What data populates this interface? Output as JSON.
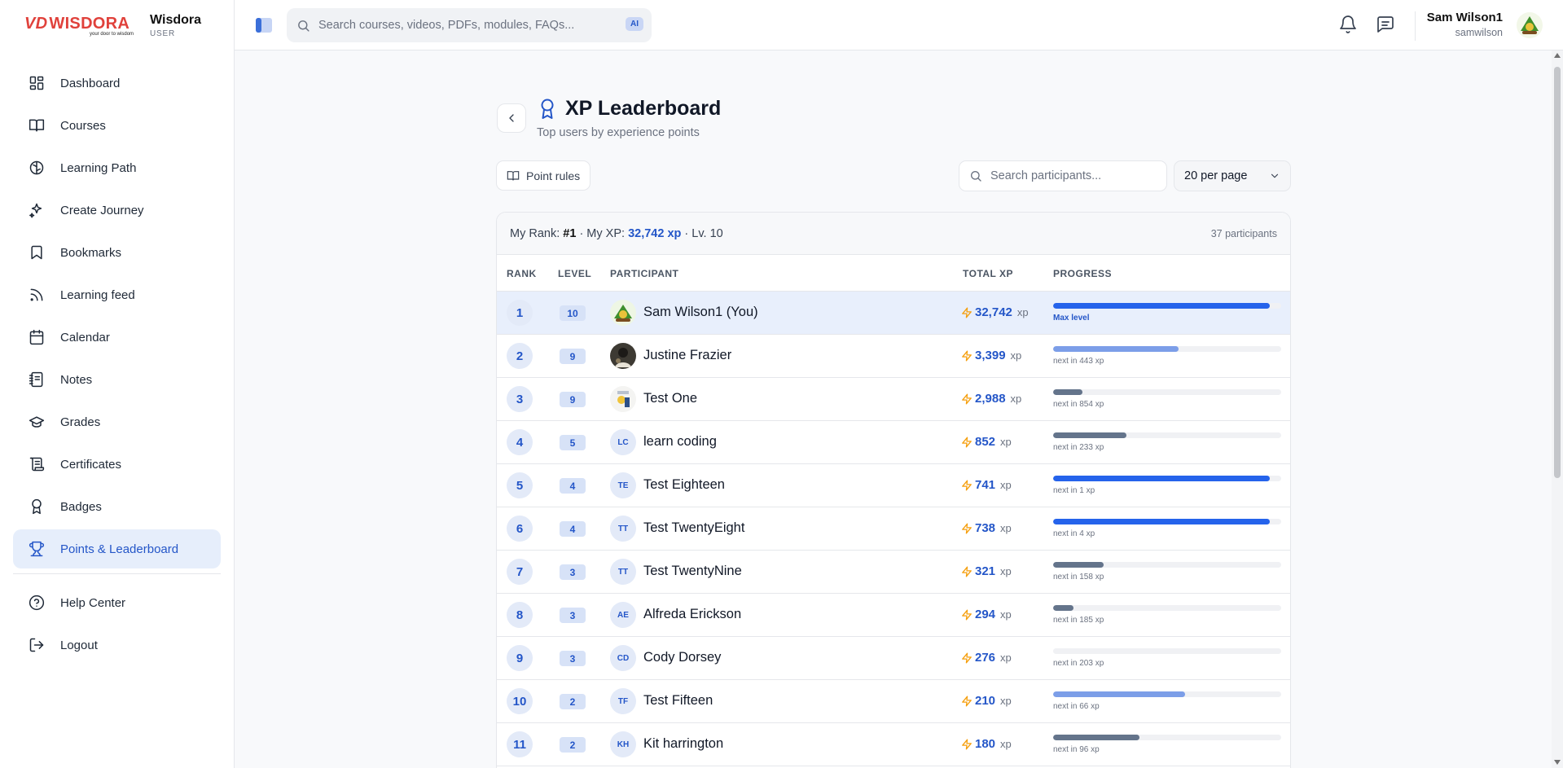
{
  "brand": {
    "logo_text": "WISDORA",
    "logo_mark": "VD",
    "logo_tagline": "your door to wisdom",
    "name": "Wisdora",
    "role": "USER"
  },
  "nav": {
    "items": [
      {
        "label": "Dashboard",
        "icon": "dashboard-icon"
      },
      {
        "label": "Courses",
        "icon": "book-open-icon"
      },
      {
        "label": "Learning Path",
        "icon": "brain-icon"
      },
      {
        "label": "Create Journey",
        "icon": "sparkles-icon"
      },
      {
        "label": "Bookmarks",
        "icon": "bookmark-icon"
      },
      {
        "label": "Learning feed",
        "icon": "rss-icon"
      },
      {
        "label": "Calendar",
        "icon": "calendar-icon"
      },
      {
        "label": "Notes",
        "icon": "notebook-icon"
      },
      {
        "label": "Grades",
        "icon": "graduation-cap-icon"
      },
      {
        "label": "Certificates",
        "icon": "scroll-icon"
      },
      {
        "label": "Badges",
        "icon": "award-icon"
      },
      {
        "label": "Points & Leaderboard",
        "icon": "trophy-icon",
        "active": true
      }
    ],
    "bottom": [
      {
        "label": "Help Center",
        "icon": "help-circle-icon"
      },
      {
        "label": "Logout",
        "icon": "logout-icon"
      }
    ]
  },
  "topbar": {
    "search_placeholder": "Search courses, videos, PDFs, modules, FAQs...",
    "ai_label": "AI",
    "user_name": "Sam Wilson1",
    "user_handle": "samwilson"
  },
  "page": {
    "title": "XP Leaderboard",
    "subtitle": "Top users by experience points",
    "rules_label": "Point rules",
    "search_placeholder": "Search participants...",
    "per_page": "20 per page"
  },
  "summary": {
    "rank_label": "My Rank:",
    "rank": "#1",
    "xp_label": "· My XP:",
    "xp": "32,742 xp",
    "level": "· Lv. 10",
    "participants": "37 participants"
  },
  "columns": {
    "rank": "RANK",
    "level": "LEVEL",
    "participant": "PARTICIPANT",
    "total_xp": "TOTAL XP",
    "progress": "PROGRESS"
  },
  "xp_unit": "xp",
  "colors": {
    "accent": "#2456c8",
    "bar_high": "#2563eb",
    "bar_mid": "#7c9ee8",
    "bar_low": "#64748b",
    "bolt": "#f59e0b"
  },
  "rows": [
    {
      "rank": "1",
      "level": "10",
      "name": "Sam Wilson1 (You)",
      "avatar": "image",
      "xp": "32,742",
      "progress": 0.95,
      "note": "Max level",
      "me": true
    },
    {
      "rank": "2",
      "level": "9",
      "name": "Justine Frazier",
      "avatar": "image",
      "xp": "3,399",
      "progress": 0.55,
      "note": "next in 443 xp"
    },
    {
      "rank": "3",
      "level": "9",
      "name": "Test One",
      "avatar": "image",
      "xp": "2,988",
      "progress": 0.13,
      "note": "next in 854 xp"
    },
    {
      "rank": "4",
      "level": "5",
      "name": "learn coding",
      "avatar": "LC",
      "xp": "852",
      "progress": 0.32,
      "note": "next in 233 xp"
    },
    {
      "rank": "5",
      "level": "4",
      "name": "Test Eighteen",
      "avatar": "TE",
      "xp": "741",
      "progress": 0.95,
      "note": "next in 1 xp"
    },
    {
      "rank": "6",
      "level": "4",
      "name": "Test TwentyEight",
      "avatar": "TT",
      "xp": "738",
      "progress": 0.95,
      "note": "next in 4 xp"
    },
    {
      "rank": "7",
      "level": "3",
      "name": "Test TwentyNine",
      "avatar": "TT",
      "xp": "321",
      "progress": 0.22,
      "note": "next in 158 xp"
    },
    {
      "rank": "8",
      "level": "3",
      "name": "Alfreda Erickson",
      "avatar": "AE",
      "xp": "294",
      "progress": 0.09,
      "note": "next in 185 xp"
    },
    {
      "rank": "9",
      "level": "3",
      "name": "Cody Dorsey",
      "avatar": "CD",
      "xp": "276",
      "progress": 0.0,
      "note": "next in 203 xp"
    },
    {
      "rank": "10",
      "level": "2",
      "name": "Test Fifteen",
      "avatar": "TF",
      "xp": "210",
      "progress": 0.58,
      "note": "next in 66 xp"
    },
    {
      "rank": "11",
      "level": "2",
      "name": "Kit harrington",
      "avatar": "KH",
      "xp": "180",
      "progress": 0.38,
      "note": "next in 96 xp"
    }
  ]
}
